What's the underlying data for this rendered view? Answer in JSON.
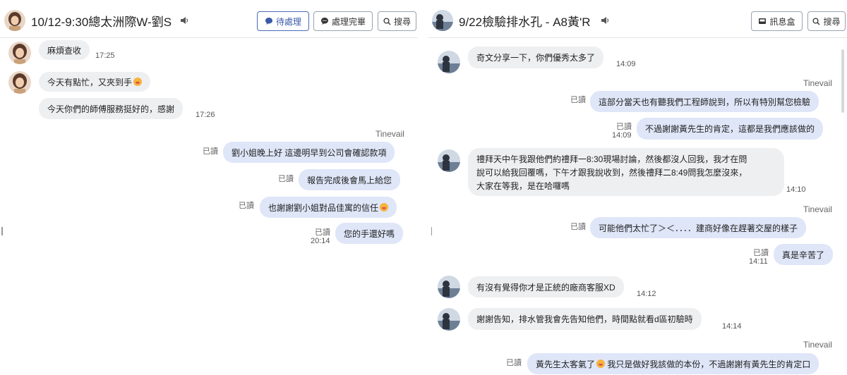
{
  "left": {
    "header": {
      "title": "10/12-9:30總太洲際W-劉S",
      "pending_label": "待處理",
      "done_label": "處理完畢",
      "search_label": "搜尋"
    },
    "messages": [
      {
        "text": "麻煩查收",
        "time": "17:25"
      },
      {
        "text": "今天有點忙，又夾到手"
      },
      {
        "text": "今天你們的師傅服務挺好的，感謝",
        "time": "17:26"
      }
    ],
    "sender": "Tinevail",
    "replies": [
      {
        "read": "已讀",
        "text": "劉小姐晚上好 這邊明早到公司會確認款項"
      },
      {
        "read": "已讀",
        "text": "報告完成後會馬上給您"
      },
      {
        "read": "已讀",
        "text": "也謝謝劉小姐對品佳寓的信任"
      },
      {
        "read": "已讀",
        "text": "您的手還好嗎",
        "time": "20:14"
      }
    ]
  },
  "right": {
    "header": {
      "title": "9/22檢驗排水孔 - A8黃'R",
      "inbox_label": "訊息盒",
      "search_label": "搜尋"
    },
    "messages": [
      {
        "text": "奇文分享一下，你們優秀太多了",
        "time": "14:09"
      },
      {
        "sender": "Tinevail",
        "read": "已讀",
        "text": "這部分當天也有聽我們工程師說到，所以有特別幫您檢驗"
      },
      {
        "read": "已讀",
        "time": "14:09",
        "text": "不過謝謝黃先生的肯定，這都是我們應該做的"
      },
      {
        "text_lines": [
          "禮拜天中午我跟他們約禮拜一8:30現場討論，然後都沒人回我，我才在問",
          "說可以給我回覆嗎，下午才跟我說收到，然後禮拜二8:49問我怎麼沒來，",
          "大家在等我，是在哈囉嗎"
        ],
        "time": "14:10"
      },
      {
        "sender": "Tinevail",
        "read": "已讀",
        "text": "可能他們太忙了＞＜．．．．建商好像在趕著交屋的樣子"
      },
      {
        "read": "已讀",
        "time": "14:11",
        "text": "真是辛苦了"
      },
      {
        "text": "有沒有覺得你才是正統的廠商客服XD",
        "time": "14:12"
      },
      {
        "text": "謝謝告知，排水管我會先告知他們，時間點就看d區初驗時",
        "time": "14:14"
      },
      {
        "sender": "Tinevail",
        "read": "已讀",
        "text_a": "黃先生太客氣了",
        "text_b": "我只是做好我該做的本份，不過謝謝有黃先生的肯定口"
      }
    ]
  },
  "colors": {
    "accent": "#3a5aa8",
    "bubble_in": "#eeeff1",
    "bubble_out": "#dfe6f8"
  }
}
